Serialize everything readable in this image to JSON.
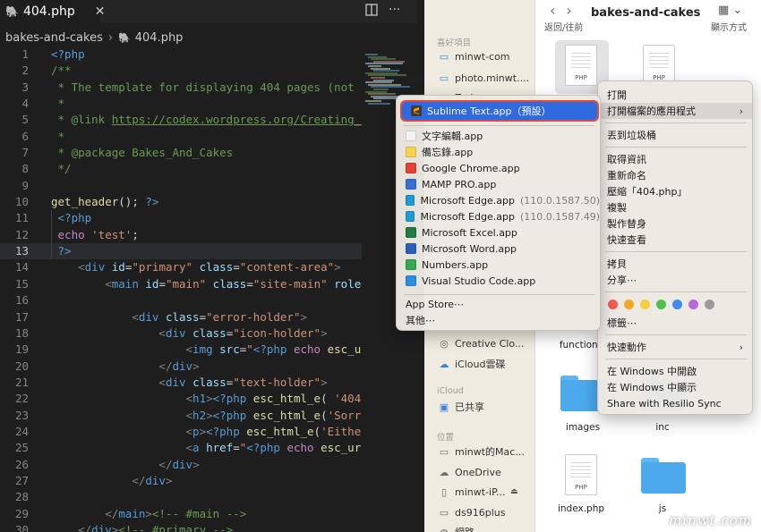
{
  "editor": {
    "tab": {
      "icon": "php-elephant-icon",
      "title": "404.php",
      "close": "✕"
    },
    "actions": {
      "split": "split-editor-icon",
      "more": "···"
    },
    "breadcrumb": {
      "folder": "bakes-and-cakes",
      "separator": "›",
      "file": "404.php"
    },
    "active_line": 13,
    "lines": [
      {
        "n": "1",
        "segs": [
          [
            "c-php",
            "<?php"
          ]
        ]
      },
      {
        "n": "2",
        "segs": [
          [
            "c-com",
            "/**"
          ]
        ]
      },
      {
        "n": "3",
        "segs": [
          [
            "c-com",
            " * The template for displaying 404 pages (not f"
          ]
        ]
      },
      {
        "n": "4",
        "segs": [
          [
            "c-com",
            " *"
          ]
        ]
      },
      {
        "n": "5",
        "segs": [
          [
            "c-com",
            " * @link "
          ],
          [
            "c-link",
            "https://codex.wordpress.org/Creating_a"
          ]
        ]
      },
      {
        "n": "6",
        "segs": [
          [
            "c-com",
            " *"
          ]
        ]
      },
      {
        "n": "7",
        "segs": [
          [
            "c-com",
            " * @package Bakes_And_Cakes"
          ]
        ]
      },
      {
        "n": "8",
        "segs": [
          [
            "c-com",
            " */"
          ]
        ]
      },
      {
        "n": "9",
        "segs": []
      },
      {
        "n": "10",
        "segs": [
          [
            "c-fn",
            "get_header"
          ],
          [
            "c-pun",
            "(); "
          ],
          [
            "c-php",
            "?>"
          ]
        ]
      },
      {
        "n": "11",
        "segs": [
          [
            "c-php",
            " <?php"
          ]
        ]
      },
      {
        "n": "12",
        "segs": [
          [
            "c-kw",
            " echo "
          ],
          [
            "c-str",
            "'test'"
          ],
          [
            "c-pun",
            ";"
          ]
        ]
      },
      {
        "n": "13",
        "segs": [
          [
            "c-php",
            " ?>"
          ]
        ]
      },
      {
        "n": "14",
        "segs": [
          [
            "c-pun",
            "    "
          ],
          [
            "c-br",
            "<"
          ],
          [
            "c-tag",
            "div "
          ],
          [
            "c-att",
            "id"
          ],
          [
            "c-pun",
            "="
          ],
          [
            "c-str",
            "\"primary\" "
          ],
          [
            "c-att",
            "class"
          ],
          [
            "c-pun",
            "="
          ],
          [
            "c-str",
            "\"content-area\""
          ],
          [
            "c-br",
            ">"
          ]
        ]
      },
      {
        "n": "15",
        "segs": [
          [
            "c-pun",
            "        "
          ],
          [
            "c-br",
            "<"
          ],
          [
            "c-tag",
            "main "
          ],
          [
            "c-att",
            "id"
          ],
          [
            "c-pun",
            "="
          ],
          [
            "c-str",
            "\"main\" "
          ],
          [
            "c-att",
            "class"
          ],
          [
            "c-pun",
            "="
          ],
          [
            "c-str",
            "\"site-main\" "
          ],
          [
            "c-att",
            "role"
          ],
          [
            "c-pun",
            "="
          ]
        ]
      },
      {
        "n": "16",
        "segs": []
      },
      {
        "n": "17",
        "segs": [
          [
            "c-pun",
            "            "
          ],
          [
            "c-br",
            "<"
          ],
          [
            "c-tag",
            "div "
          ],
          [
            "c-att",
            "class"
          ],
          [
            "c-pun",
            "="
          ],
          [
            "c-str",
            "\"error-holder\""
          ],
          [
            "c-br",
            ">"
          ]
        ]
      },
      {
        "n": "18",
        "segs": [
          [
            "c-pun",
            "                "
          ],
          [
            "c-br",
            "<"
          ],
          [
            "c-tag",
            "div "
          ],
          [
            "c-att",
            "class"
          ],
          [
            "c-pun",
            "="
          ],
          [
            "c-str",
            "\"icon-holder\""
          ],
          [
            "c-br",
            ">"
          ]
        ]
      },
      {
        "n": "19",
        "segs": [
          [
            "c-pun",
            "                    "
          ],
          [
            "c-br",
            "<"
          ],
          [
            "c-tag",
            "img "
          ],
          [
            "c-att",
            "src"
          ],
          [
            "c-pun",
            "="
          ],
          [
            "c-str",
            "\""
          ],
          [
            "c-php",
            "<?php "
          ],
          [
            "c-kw",
            "echo "
          ],
          [
            "c-ec",
            "esc_url"
          ]
        ]
      },
      {
        "n": "20",
        "segs": [
          [
            "c-pun",
            "                "
          ],
          [
            "c-br",
            "</"
          ],
          [
            "c-tag",
            "div"
          ],
          [
            "c-br",
            ">"
          ]
        ]
      },
      {
        "n": "21",
        "segs": [
          [
            "c-pun",
            "                "
          ],
          [
            "c-br",
            "<"
          ],
          [
            "c-tag",
            "div "
          ],
          [
            "c-att",
            "class"
          ],
          [
            "c-pun",
            "="
          ],
          [
            "c-str",
            "\"text-holder\""
          ],
          [
            "c-br",
            ">"
          ]
        ]
      },
      {
        "n": "22",
        "segs": [
          [
            "c-pun",
            "                    "
          ],
          [
            "c-br",
            "<"
          ],
          [
            "c-tag",
            "h1"
          ],
          [
            "c-br",
            ">"
          ],
          [
            "c-php",
            "<?php "
          ],
          [
            "c-ec",
            "esc_html_e"
          ],
          [
            "c-pun",
            "( "
          ],
          [
            "c-str",
            "'404"
          ]
        ]
      },
      {
        "n": "23",
        "segs": [
          [
            "c-pun",
            "                    "
          ],
          [
            "c-br",
            "<"
          ],
          [
            "c-tag",
            "h2"
          ],
          [
            "c-br",
            ">"
          ],
          [
            "c-php",
            "<?php "
          ],
          [
            "c-ec",
            "esc_html_e"
          ],
          [
            "c-pun",
            "("
          ],
          [
            "c-str",
            "'Sorry"
          ]
        ]
      },
      {
        "n": "24",
        "segs": [
          [
            "c-pun",
            "                    "
          ],
          [
            "c-br",
            "<"
          ],
          [
            "c-tag",
            "p"
          ],
          [
            "c-br",
            ">"
          ],
          [
            "c-php",
            "<?php "
          ],
          [
            "c-ec",
            "esc_html_e"
          ],
          [
            "c-pun",
            "("
          ],
          [
            "c-str",
            "'Either"
          ]
        ]
      },
      {
        "n": "25",
        "segs": [
          [
            "c-pun",
            "                    "
          ],
          [
            "c-br",
            "<"
          ],
          [
            "c-tag",
            "a "
          ],
          [
            "c-att",
            "href"
          ],
          [
            "c-pun",
            "="
          ],
          [
            "c-str",
            "\""
          ],
          [
            "c-php",
            "<?php "
          ],
          [
            "c-kw",
            "echo "
          ],
          [
            "c-ec",
            "esc_url"
          ]
        ]
      },
      {
        "n": "26",
        "segs": [
          [
            "c-pun",
            "                "
          ],
          [
            "c-br",
            "</"
          ],
          [
            "c-tag",
            "div"
          ],
          [
            "c-br",
            ">"
          ]
        ]
      },
      {
        "n": "27",
        "segs": [
          [
            "c-pun",
            "            "
          ],
          [
            "c-br",
            "</"
          ],
          [
            "c-tag",
            "div"
          ],
          [
            "c-br",
            ">"
          ]
        ]
      },
      {
        "n": "28",
        "segs": []
      },
      {
        "n": "29",
        "segs": [
          [
            "c-pun",
            "        "
          ],
          [
            "c-br",
            "</"
          ],
          [
            "c-tag",
            "main"
          ],
          [
            "c-br",
            ">"
          ],
          [
            "c-com",
            "<!-- #main -->"
          ]
        ]
      },
      {
        "n": "30",
        "segs": [
          [
            "c-pun",
            "    "
          ],
          [
            "c-br",
            "</"
          ],
          [
            "c-tag",
            "div"
          ],
          [
            "c-br",
            ">"
          ],
          [
            "c-com",
            "<!-- #primary -->"
          ]
        ]
      }
    ]
  },
  "finder": {
    "nav_label": "返回/往前",
    "title": "bakes-and-cakes",
    "view_label": "顯示方式",
    "sidebar": {
      "favorites_header": "喜好項目",
      "favorites": [
        "minwt-com",
        "photo.minwt....",
        "Z-cha..."
      ],
      "items_mid": [
        "Creative Clo...",
        "iCloud雲碟"
      ],
      "icloud_header": "iCloud",
      "icloud_items": [
        "已共享"
      ],
      "locations_header": "位置",
      "locations": [
        "minwt的Mac...",
        "OneDrive",
        "minwt-iP...",
        "ds916plus",
        "網路"
      ]
    },
    "files": {
      "selected_ext": "PHP",
      "file2_ext": "PHP",
      "functions_label": "functions.p",
      "images_label": "images",
      "inc_label": "inc",
      "index_label": "index.php",
      "index_ext": "PHP",
      "js_label": "js"
    }
  },
  "context_menu": {
    "items": [
      "打開",
      "打開檔案的應用程式",
      "丟到垃圾桶",
      "取得資訊",
      "重新命名",
      "壓縮「404.php」",
      "複製",
      "製作替身",
      "快速查看",
      "拷貝",
      "分享⋯",
      "標籤⋯",
      "快速動作",
      "在 Windows 中開啟",
      "在 Windows 中顯示",
      "Share with Resilio Sync"
    ],
    "submenu_arrow": "›",
    "tag_colors": [
      "#f45a52",
      "#f5a623",
      "#f7cc3e",
      "#4cc04d",
      "#3d8ef0",
      "#b766dc",
      "#9a9a9a"
    ]
  },
  "apps_menu": {
    "default_app": "Sublime Text.app（預設）",
    "apps": [
      {
        "name": "文字編輯.app",
        "version": "",
        "color": "#f2f2f2"
      },
      {
        "name": "備忘錄.app",
        "version": "",
        "color": "#f7d34a"
      },
      {
        "name": "Google Chrome.app",
        "version": "",
        "color": "#e34133"
      },
      {
        "name": "MAMP PRO.app",
        "version": "",
        "color": "#3a6fd8"
      },
      {
        "name": "Microsoft Edge.app",
        "version": "(110.0.1587.50)",
        "color": "#1d9bd6"
      },
      {
        "name": "Microsoft Edge.app",
        "version": "(110.0.1587.49)",
        "color": "#1d9bd6"
      },
      {
        "name": "Microsoft Excel.app",
        "version": "",
        "color": "#1f7a43"
      },
      {
        "name": "Microsoft Word.app",
        "version": "",
        "color": "#2b5fb9"
      },
      {
        "name": "Numbers.app",
        "version": "",
        "color": "#33a852"
      },
      {
        "name": "Visual Studio Code.app",
        "version": "",
        "color": "#2a8ee0"
      }
    ],
    "app_store": "App Store⋯",
    "other": "其他⋯"
  },
  "watermark": "minwt.com"
}
